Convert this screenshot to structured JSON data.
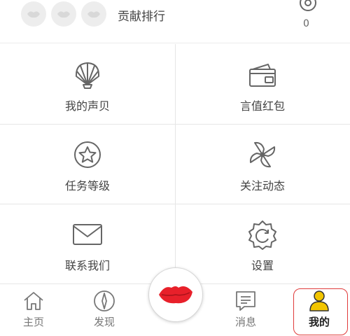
{
  "ranking": {
    "label": "贡献排行",
    "count": "0",
    "avatars": [
      "avatar-placeholder",
      "avatar-placeholder",
      "avatar-placeholder"
    ]
  },
  "menu": {
    "items": [
      {
        "label": "我的声贝",
        "icon": "shell-icon"
      },
      {
        "label": "言值红包",
        "icon": "wallet-icon"
      },
      {
        "label": "任务等级",
        "icon": "star-badge-icon"
      },
      {
        "label": "关注动态",
        "icon": "pinwheel-icon"
      },
      {
        "label": "联系我们",
        "icon": "mail-icon"
      },
      {
        "label": "设置",
        "icon": "gear-icon"
      }
    ]
  },
  "nav": {
    "items": [
      {
        "label": "主页",
        "icon": "home-icon"
      },
      {
        "label": "发现",
        "icon": "compass-icon"
      },
      {
        "label": "消息",
        "icon": "message-icon"
      },
      {
        "label": "我的",
        "icon": "user-icon",
        "active": true
      }
    ],
    "center_icon": "lips-icon"
  },
  "colors": {
    "accent_red": "#e8202a",
    "active_yellow": "#f2c500",
    "active_frame": "#e03b3b",
    "icon_gray": "#666666"
  }
}
